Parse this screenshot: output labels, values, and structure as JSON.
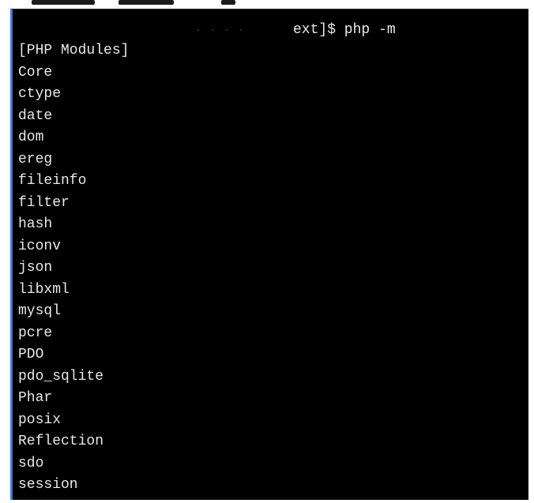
{
  "terminal": {
    "command_line": "ext]$ php -m",
    "output_header": "[PHP Modules]",
    "modules": [
      "Core",
      "ctype",
      "date",
      "dom",
      "ereg",
      "fileinfo",
      "filter",
      "hash",
      "iconv",
      "json",
      "libxml",
      "mysql",
      "pcre",
      "PDO",
      "pdo_sqlite",
      "Phar",
      "posix",
      "Reflection",
      "sdo",
      "session"
    ],
    "colors": {
      "background": "#000000",
      "foreground": "#e8e8e8",
      "window_border": "#3a7bd5"
    }
  }
}
